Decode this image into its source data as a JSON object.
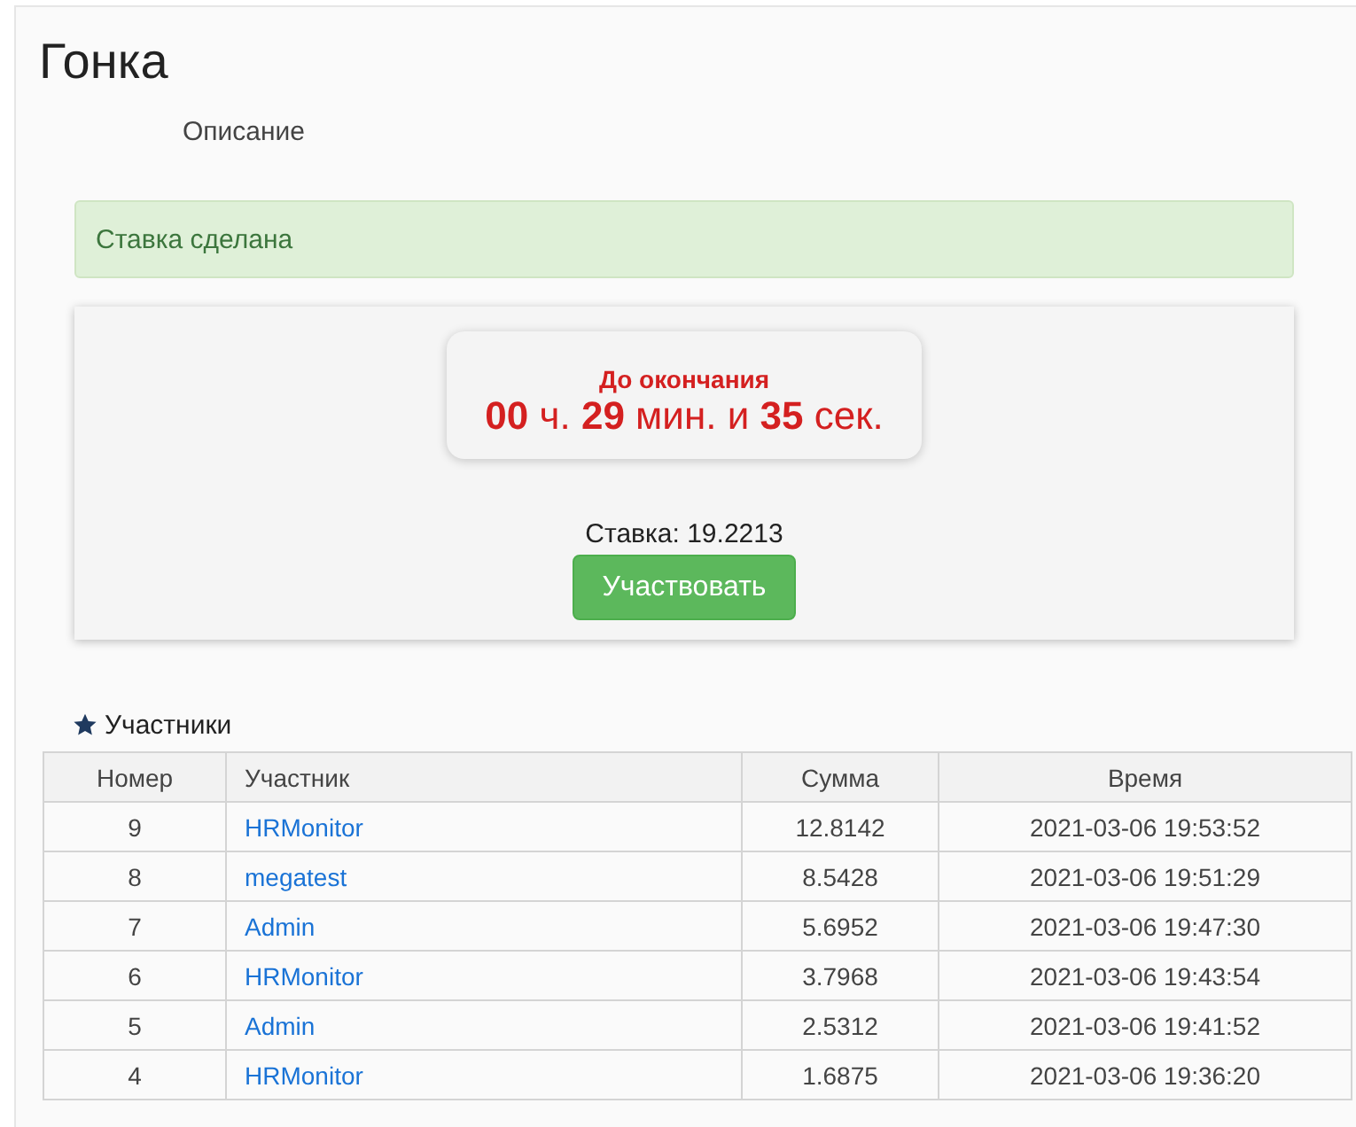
{
  "title": "Гонка",
  "description": "Описание",
  "alert": "Ставка сделана",
  "timer": {
    "label": "До окончания",
    "value": "**00** ч. **29** мин. и **35** сек."
  },
  "stake": "Ставка: 19.2213",
  "participate_button": "Участвовать",
  "participants": {
    "heading": "Участники",
    "columns": [
      "Номер",
      "Участник",
      "Сумма",
      "Время"
    ],
    "rows": [
      {
        "number": "9",
        "user": "HRMonitor",
        "sum": "12.8142",
        "time": "2021-03-06 19:53:52"
      },
      {
        "number": "8",
        "user": "megatest",
        "sum": "8.5428",
        "time": "2021-03-06 19:51:29"
      },
      {
        "number": "7",
        "user": "Admin",
        "sum": "5.6952",
        "time": "2021-03-06 19:47:30"
      },
      {
        "number": "6",
        "user": "HRMonitor",
        "sum": "3.7968",
        "time": "2021-03-06 19:43:54"
      },
      {
        "number": "5",
        "user": "Admin",
        "sum": "2.5312",
        "time": "2021-03-06 19:41:52"
      },
      {
        "number": "4",
        "user": "HRMonitor",
        "sum": "1.6875",
        "time": "2021-03-06 19:36:20"
      }
    ]
  }
}
